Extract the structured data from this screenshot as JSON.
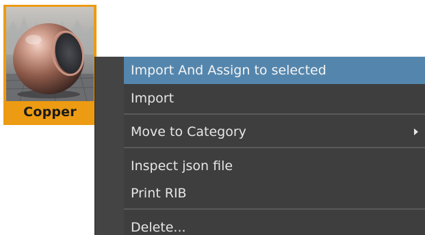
{
  "material": {
    "name": "Copper",
    "preview_icon": "copper-sphere-preview",
    "tile_color": "#ec9b12"
  },
  "context_menu": {
    "items": [
      {
        "label": "Import And Assign to selected",
        "highlighted": true
      },
      {
        "label": "Import"
      },
      {
        "label": "Move to Category",
        "has_submenu": true,
        "submenu_icon": "chevron-right-icon"
      },
      {
        "label": "Inspect json file"
      },
      {
        "label": "Print RIB"
      },
      {
        "label": "Delete..."
      }
    ],
    "highlight_color": "#5486ad",
    "background_color": "#3e3e3e"
  }
}
